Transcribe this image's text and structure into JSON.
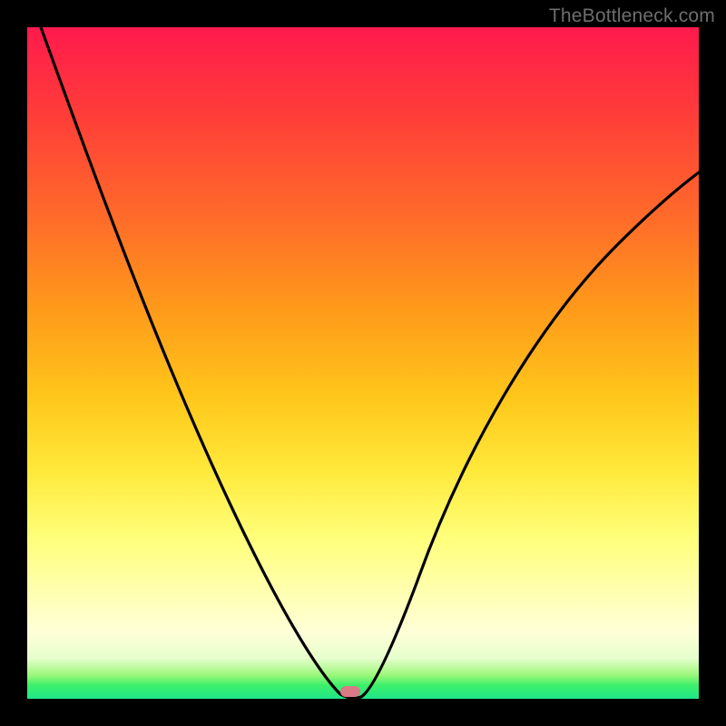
{
  "watermark": "TheBottleneck.com",
  "chart_data": {
    "type": "line",
    "title": "",
    "xlabel": "",
    "ylabel": "",
    "xlim": [
      0,
      100
    ],
    "ylim": [
      0,
      100
    ],
    "series": [
      {
        "name": "bottleneck-curve",
        "x": [
          2,
          6,
          10,
          14,
          18,
          22,
          26,
          30,
          34,
          38,
          42,
          44,
          46,
          47,
          48,
          49,
          50,
          52,
          54,
          58,
          62,
          66,
          70,
          74,
          78,
          82,
          86,
          90,
          94,
          98
        ],
        "y": [
          100,
          92,
          84,
          76,
          68,
          60,
          52,
          44,
          36,
          28,
          18,
          12,
          6,
          3,
          1,
          0.5,
          1,
          4,
          10,
          20,
          30,
          38,
          45,
          51,
          56,
          60,
          63,
          66,
          68,
          70
        ]
      }
    ],
    "marker": {
      "x": 48,
      "y": 0
    },
    "background": "heatmap-gradient",
    "colors": {
      "curve": "#000000",
      "marker": "#d97a85",
      "frame": "#000000"
    }
  },
  "icons": {
    "curve": "bottleneck-curve",
    "marker": "optimum-marker"
  }
}
